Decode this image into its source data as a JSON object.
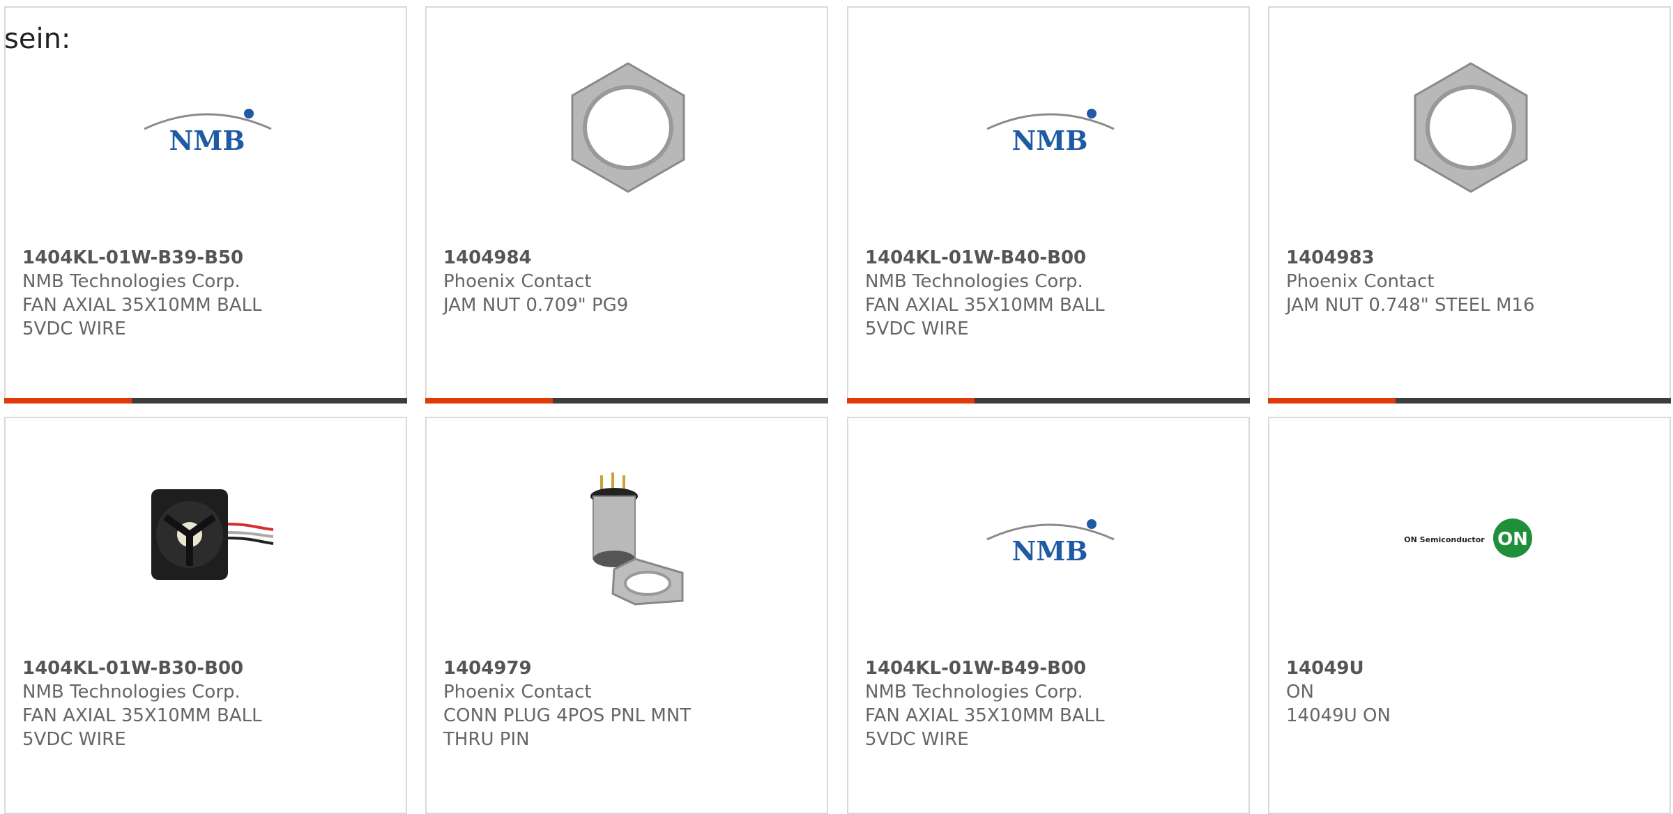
{
  "intro": "sein:",
  "colors": {
    "accent": "#e03a0a",
    "bar": "#3d3d3d",
    "nmb_blue": "#1f5aa6",
    "on_green": "#1f8f3a"
  },
  "products": [
    {
      "part": "1404KL-01W-B39-B50",
      "maker": "NMB Technologies Corp.",
      "desc": "FAN AXIAL 35X10MM BALL 5VDC WIRE",
      "image": "nmb-logo"
    },
    {
      "part": "1404984",
      "maker": "Phoenix Contact",
      "desc": "JAM NUT 0.709\" PG9",
      "image": "hex-nut"
    },
    {
      "part": "1404KL-01W-B40-B00",
      "maker": "NMB Technologies Corp.",
      "desc": "FAN AXIAL 35X10MM BALL 5VDC WIRE",
      "image": "nmb-logo"
    },
    {
      "part": "1404983",
      "maker": "Phoenix Contact",
      "desc": "JAM NUT 0.748\" STEEL M16",
      "image": "hex-nut"
    },
    {
      "part": "1404KL-01W-B30-B00",
      "maker": "NMB Technologies Corp.",
      "desc": "FAN AXIAL 35X10MM BALL 5VDC WIRE",
      "image": "fan"
    },
    {
      "part": "1404979",
      "maker": "Phoenix Contact",
      "desc": "CONN PLUG 4POS PNL MNT THRU PIN",
      "image": "connector"
    },
    {
      "part": "1404KL-01W-B49-B00",
      "maker": "NMB Technologies Corp.",
      "desc": "FAN AXIAL 35X10MM BALL 5VDC WIRE",
      "image": "nmb-logo"
    },
    {
      "part": "14049U",
      "maker": "ON",
      "desc": "14049U ON",
      "image": "on-logo"
    }
  ],
  "logo_text": {
    "nmb": "NMB",
    "on_company": "ON Semiconductor",
    "on_mark": "ON"
  }
}
